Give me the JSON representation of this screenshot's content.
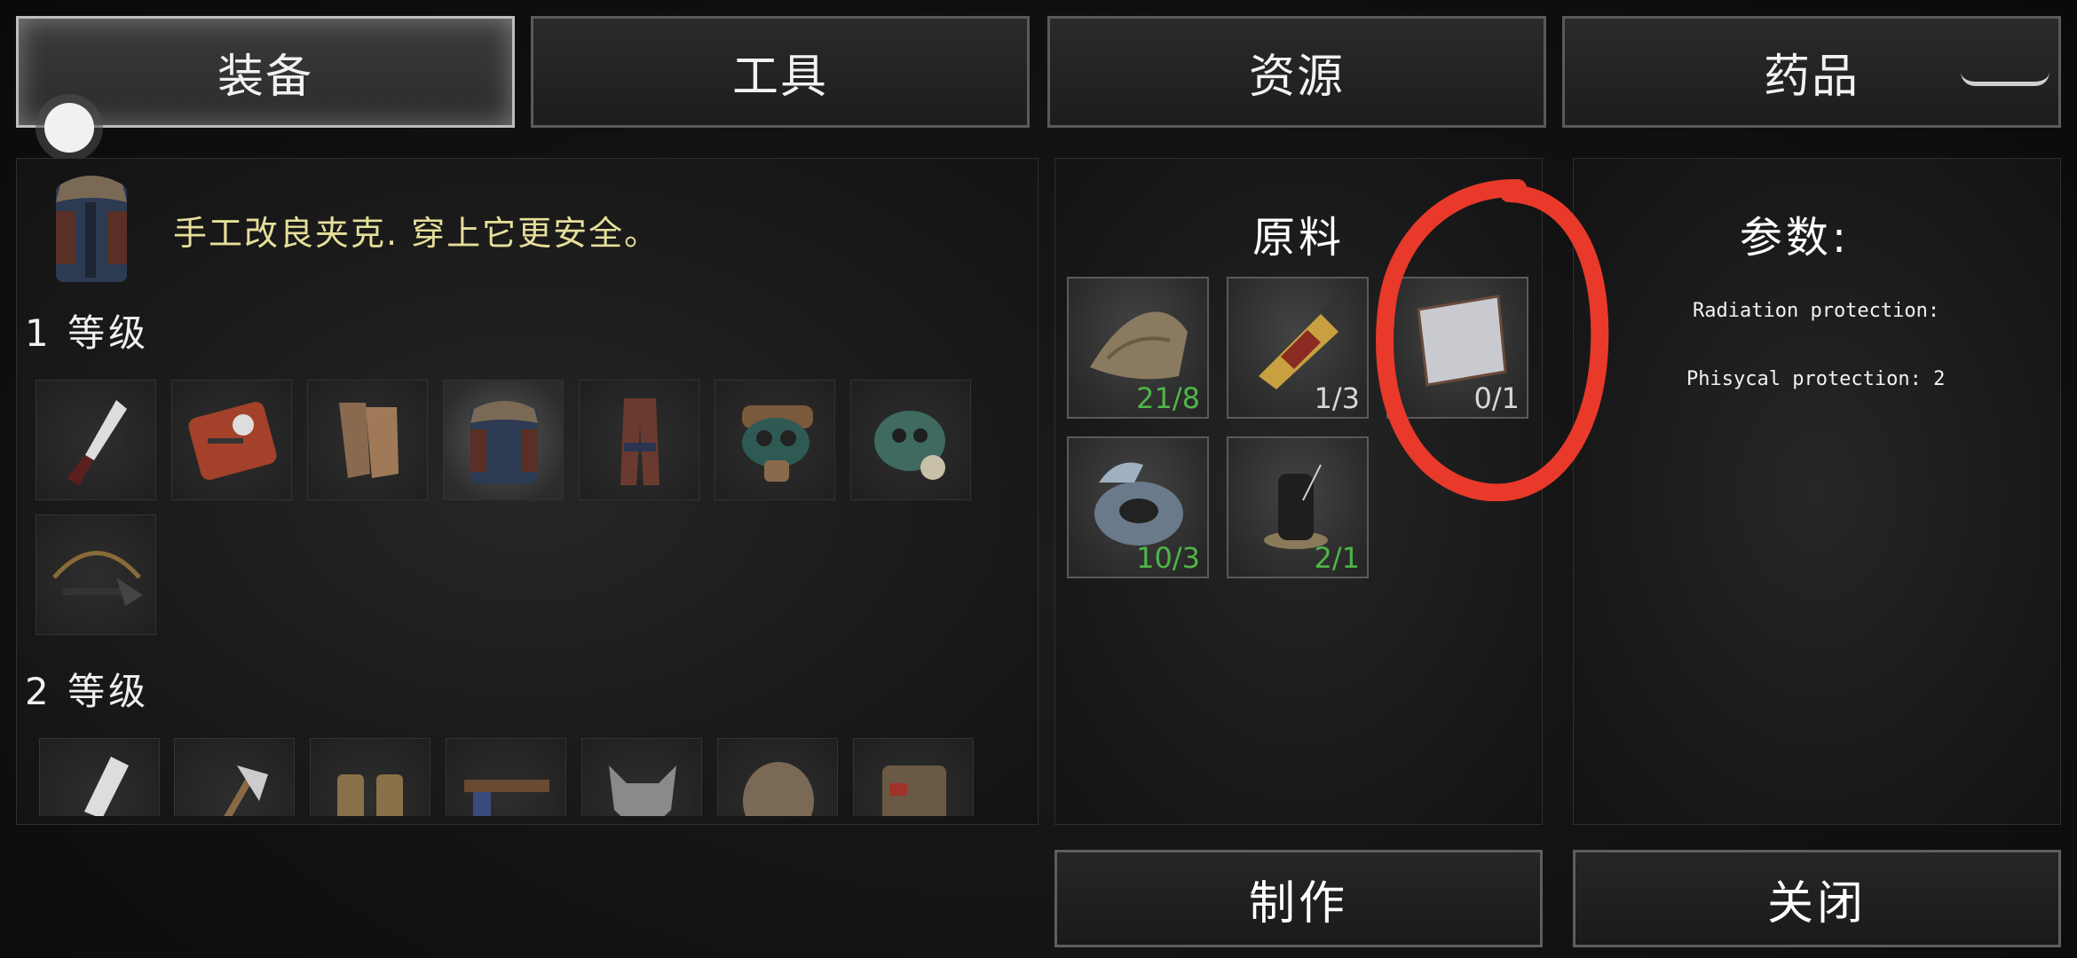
{
  "tabs": [
    {
      "label": "装备",
      "active": true
    },
    {
      "label": "工具",
      "active": false
    },
    {
      "label": "资源",
      "active": false
    },
    {
      "label": "药品",
      "active": false
    }
  ],
  "item_description": "手工改良夹克. 穿上它更安全。",
  "levels": [
    {
      "label": "1 等级",
      "items": [
        "knife-icon",
        "radio-icon",
        "gloves-icon",
        "jacket-icon",
        "pants-icon",
        "gas-mask-icon",
        "respirator-icon",
        "crossbow-icon"
      ]
    },
    {
      "label": "2 等级",
      "items": [
        "big-knife-icon",
        "axe-icon",
        "binoculars-icon",
        "pistol-icon",
        "wolf-head-icon",
        "fur-hood-icon",
        "armored-jacket-icon"
      ]
    }
  ],
  "materials": {
    "title": "原料",
    "items": [
      {
        "icon": "cloth-icon",
        "count": "21/8",
        "sufficient": true
      },
      {
        "icon": "glue-tube-icon",
        "count": "1/3",
        "sufficient": false
      },
      {
        "icon": "metal-sheet-icon",
        "count": "0/1",
        "sufficient": false
      },
      {
        "icon": "duct-tape-icon",
        "count": "10/3",
        "sufficient": true
      },
      {
        "icon": "thread-spool-icon",
        "count": "2/1",
        "sufficient": true
      }
    ]
  },
  "params": {
    "title": "参数:",
    "lines": [
      "Radiation protection:",
      "Phisycal protection: 2"
    ]
  },
  "buttons": {
    "craft": "制作",
    "close": "关闭"
  },
  "colors": {
    "sufficient": "#4fb548",
    "insufficient": "#d8d8d8",
    "annotation": "#e8392a",
    "description": "#e6df9a"
  }
}
